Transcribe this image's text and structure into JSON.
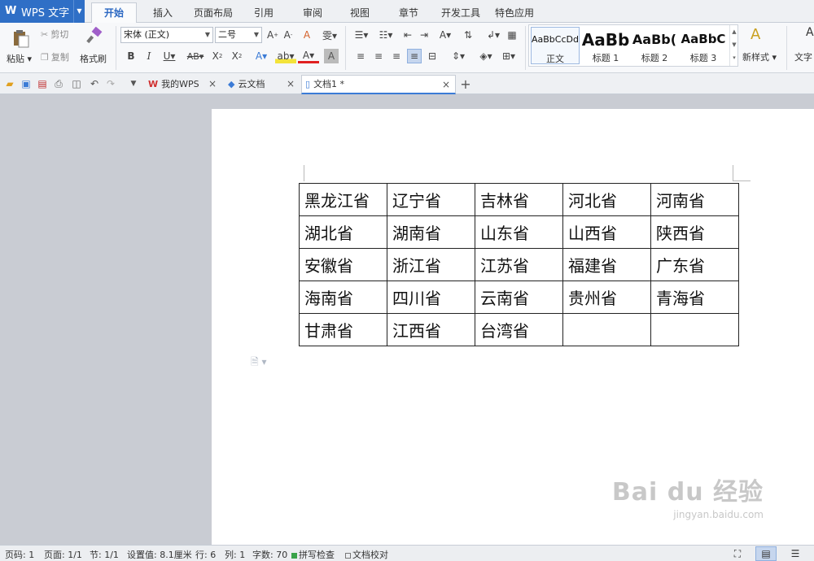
{
  "app": {
    "title": "WPS 文字",
    "brand_color": "#2f6fc6"
  },
  "menu": {
    "tabs": [
      {
        "label": "开始",
        "active": true
      },
      {
        "label": "插入"
      },
      {
        "label": "页面布局"
      },
      {
        "label": "引用"
      },
      {
        "label": "审阅"
      },
      {
        "label": "视图"
      },
      {
        "label": "章节"
      },
      {
        "label": "开发工具"
      },
      {
        "label": "特色应用"
      }
    ]
  },
  "ribbon": {
    "paste_label": "粘贴",
    "cut_label": "剪切",
    "copy_label": "复制",
    "format_painter_label": "格式刷",
    "font_name": "宋体 (正文)",
    "font_size": "二号",
    "styles": [
      {
        "sample": "AaBbCcDd",
        "name": "正文"
      },
      {
        "sample": "AaBb",
        "name": "标题 1"
      },
      {
        "sample": "AaBb(",
        "name": "标题 2"
      },
      {
        "sample": "AaBbC",
        "name": "标题 3"
      }
    ],
    "new_style_label": "新样式",
    "text_tools_label": "文字"
  },
  "tabs": [
    {
      "label": "我的WPS"
    },
    {
      "label": "云文档"
    },
    {
      "label": "文档1 *",
      "active": true
    }
  ],
  "table": {
    "rows": [
      [
        "黑龙江省",
        "辽宁省",
        "吉林省",
        "河北省",
        "河南省"
      ],
      [
        "湖北省",
        "湖南省",
        "山东省",
        "山西省",
        "陕西省"
      ],
      [
        "安徽省",
        "浙江省",
        "江苏省",
        "福建省",
        "广东省"
      ],
      [
        "海南省",
        "四川省",
        "云南省",
        "贵州省",
        "青海省"
      ],
      [
        "甘肃省",
        "江西省",
        "台湾省",
        "",
        ""
      ]
    ]
  },
  "status": {
    "page_no": "页码: 1",
    "pages": "页面: 1/1",
    "section": "节: 1/1",
    "setting": "设置值: 8.1厘米",
    "row": "行: 6",
    "col": "列: 1",
    "word_count": "字数: 70",
    "spell_check": "拼写检查",
    "doc_proof": "文档校对"
  },
  "watermark": {
    "brand": "Bai du 经验",
    "url": "jingyan.baidu.com"
  }
}
